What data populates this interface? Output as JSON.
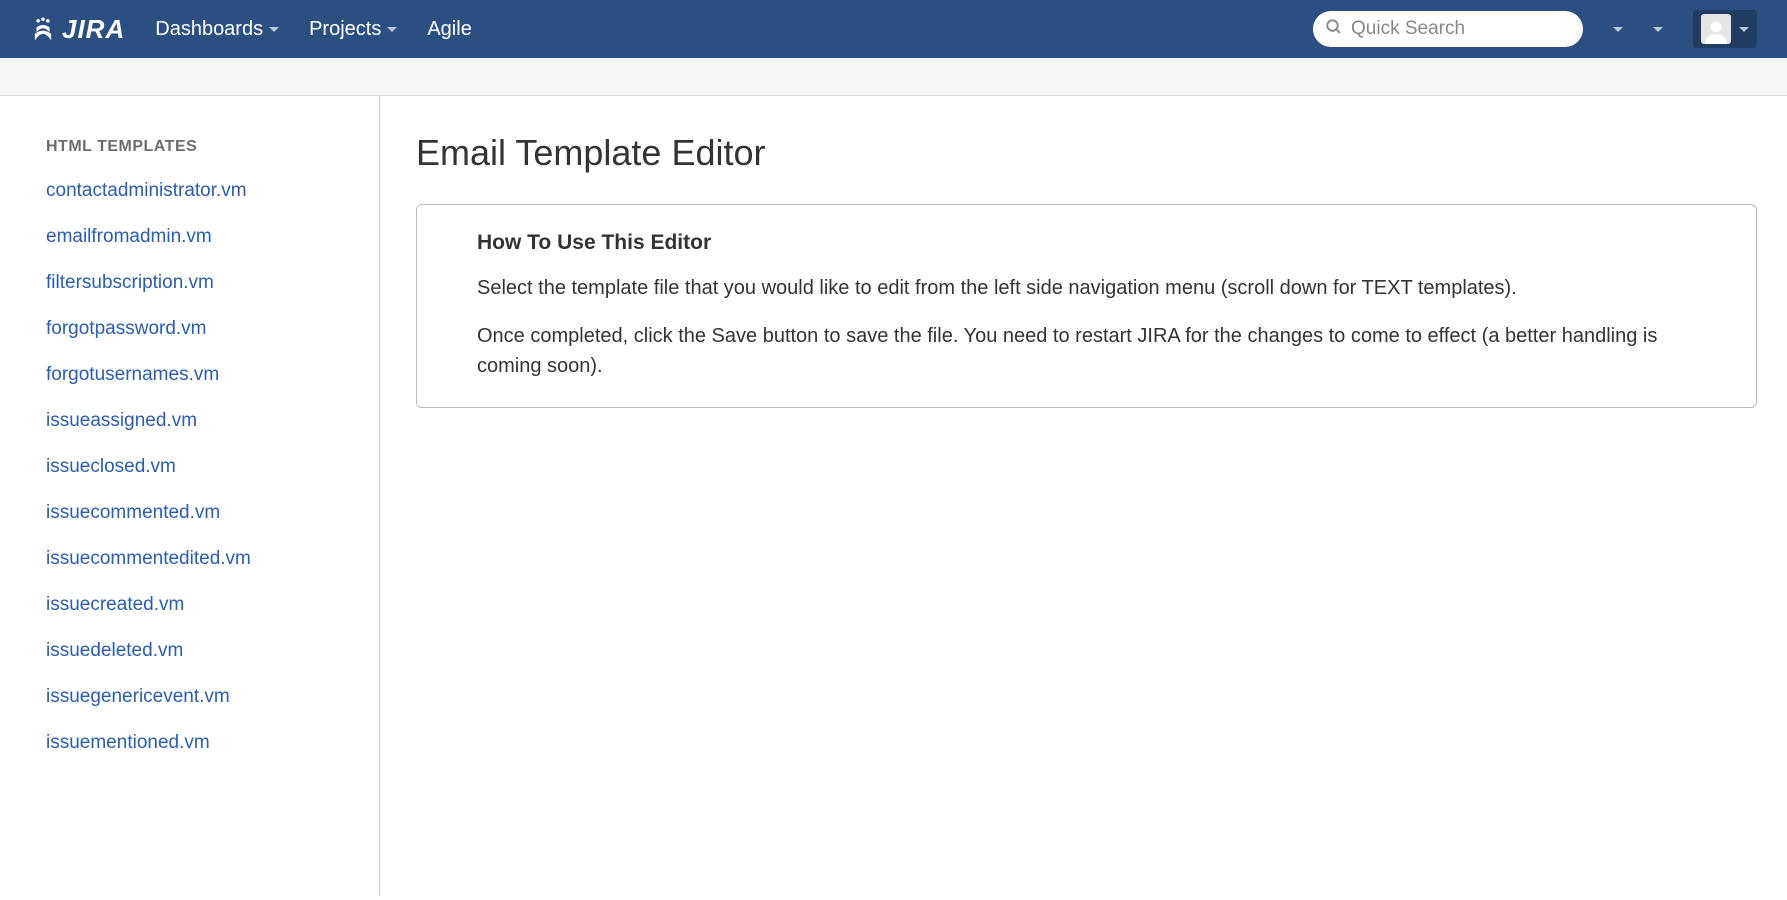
{
  "header": {
    "logo_text": "JIRA",
    "nav": [
      {
        "label": "Dashboards",
        "has_caret": true
      },
      {
        "label": "Projects",
        "has_caret": true
      },
      {
        "label": "Agile",
        "has_caret": false
      }
    ],
    "search_placeholder": "Quick Search"
  },
  "sidebar": {
    "heading": "HTML TEMPLATES",
    "items": [
      "contactadministrator.vm",
      "emailfromadmin.vm",
      "filtersubscription.vm",
      "forgotpassword.vm",
      "forgotusernames.vm",
      "issueassigned.vm",
      "issueclosed.vm",
      "issuecommented.vm",
      "issuecommentedited.vm",
      "issuecreated.vm",
      "issuedeleted.vm",
      "issuegenericevent.vm",
      "issuementioned.vm"
    ]
  },
  "main": {
    "title": "Email Template Editor",
    "panel": {
      "heading": "How To Use This Editor",
      "p1": "Select the template file that you would like to edit from the left side navigation menu (scroll down for TEXT templates).",
      "p2": "Once completed, click the Save button to save the file. You need to restart JIRA for the changes to come to effect (a better handling is coming soon)."
    }
  }
}
